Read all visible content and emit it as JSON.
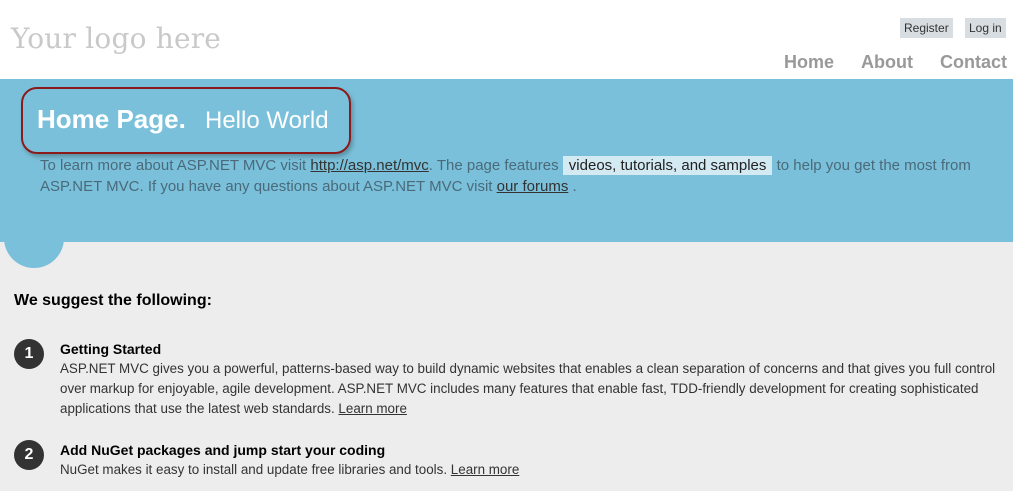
{
  "header": {
    "logo": "Your logo here",
    "auth": {
      "register": "Register",
      "login": "Log in"
    },
    "nav": [
      {
        "label": "Home"
      },
      {
        "label": "About"
      },
      {
        "label": "Contact"
      }
    ]
  },
  "featured": {
    "title": "Home Page.",
    "subtitle": "Hello World",
    "text_1": "To learn more about ASP.NET MVC visit",
    "link_mvc": "http://asp.net/mvc",
    "text_2": ". The page features",
    "highlight": "videos, tutorials, and samples",
    "text_3": "to help you get the most from ASP.NET MVC. If you have any questions about ASP.NET MVC visit",
    "link_forums": "our forums",
    "text_4": "."
  },
  "main": {
    "heading": "We suggest the following:",
    "steps": [
      {
        "number": "1",
        "title": "Getting Started",
        "text": "ASP.NET MVC gives you a powerful, patterns-based way to build dynamic websites that enables a clean separation of concerns and that gives you full control over markup for enjoyable, agile development. ASP.NET MVC includes many features that enable fast, TDD-friendly development for creating sophisticated applications that use the latest web standards.",
        "link": "Learn more"
      },
      {
        "number": "2",
        "title": "Add NuGet packages and jump start your coding",
        "text": "NuGet makes it easy to install and update free libraries and tools.",
        "link": "Learn more"
      }
    ]
  },
  "colors": {
    "featured_bg": "#7ac0da",
    "page_bg": "#ededed",
    "title_outline": "#8b1a1a"
  }
}
